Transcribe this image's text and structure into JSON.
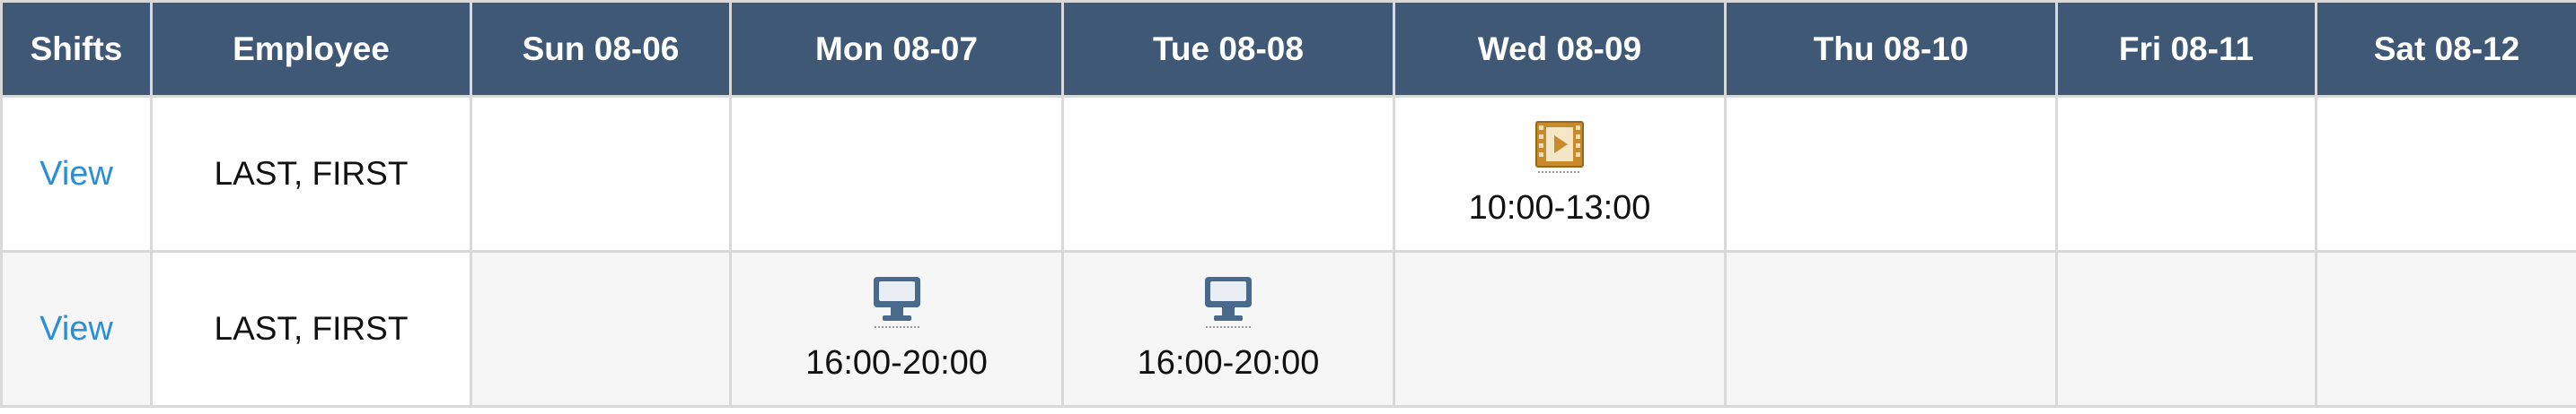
{
  "headers": {
    "shifts": "Shifts",
    "employee": "Employee",
    "days": [
      "Sun 08-06",
      "Mon 08-07",
      "Tue 08-08",
      "Wed 08-09",
      "Thu 08-10",
      "Fri 08-11",
      "Sat 08-12"
    ]
  },
  "rows": [
    {
      "view_label": "View",
      "employee": "LAST, FIRST",
      "shifts": [
        "",
        "",
        "",
        "10:00-13:00",
        "",
        "",
        ""
      ],
      "shift_icons": [
        "",
        "",
        "",
        "film-icon",
        "",
        "",
        ""
      ]
    },
    {
      "view_label": "View",
      "employee": "LAST, FIRST",
      "shifts": [
        "",
        "16:00-20:00",
        "16:00-20:00",
        "",
        "",
        "",
        ""
      ],
      "shift_icons": [
        "",
        "monitor-icon",
        "monitor-icon",
        "",
        "",
        "",
        ""
      ]
    }
  ],
  "colors": {
    "header_bg": "#3e5875",
    "link": "#2a8fd6",
    "film_icon": "#c98a2c",
    "monitor_icon": "#4a6a8c"
  }
}
